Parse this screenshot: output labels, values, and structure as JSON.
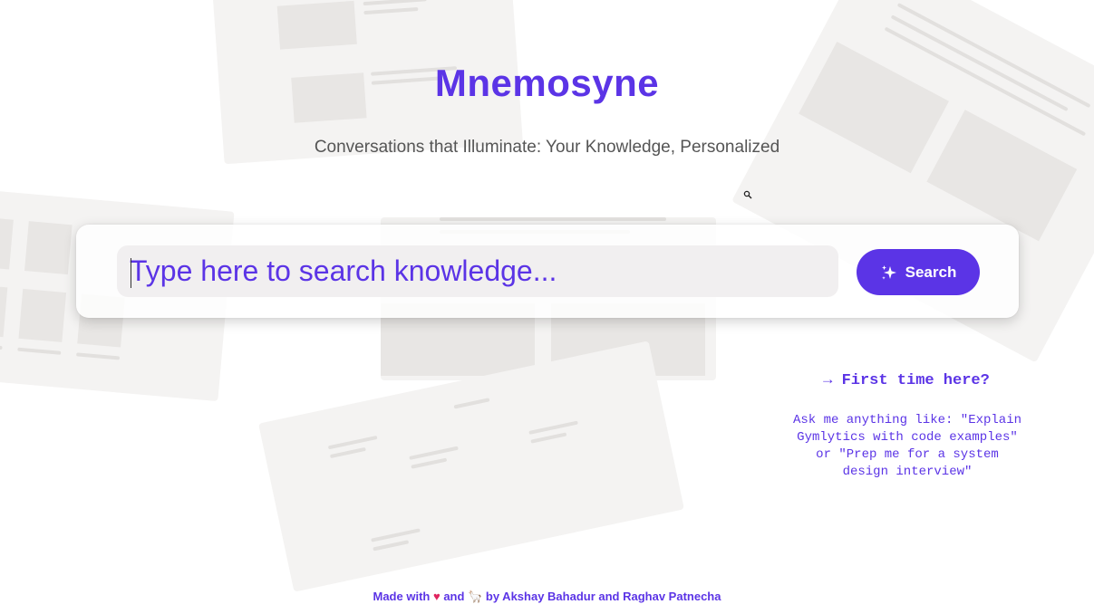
{
  "header": {
    "title": "Mnemosyne",
    "subtitle": "Conversations that Illuminate: Your Knowledge, Personalized"
  },
  "search": {
    "placeholder": "Type here to search knowledge...",
    "value": "",
    "button_label": "Search",
    "button_icon": "sparkle-icon"
  },
  "help": {
    "title": "→ First time here?",
    "body": "Ask me anything like: \"Explain Gymlytics with code examples\" or \"Prep me for a system design interview\""
  },
  "footer": {
    "prefix": "Made with",
    "heart": "♥",
    "and": "and",
    "llama": "🦙",
    "suffix": "by Akshay Bahadur and Raghav Patnecha"
  },
  "colors": {
    "accent": "#5b34e6",
    "background": "#ffffff",
    "heart": "#e0245e",
    "input_bg": "#f1eff0"
  }
}
